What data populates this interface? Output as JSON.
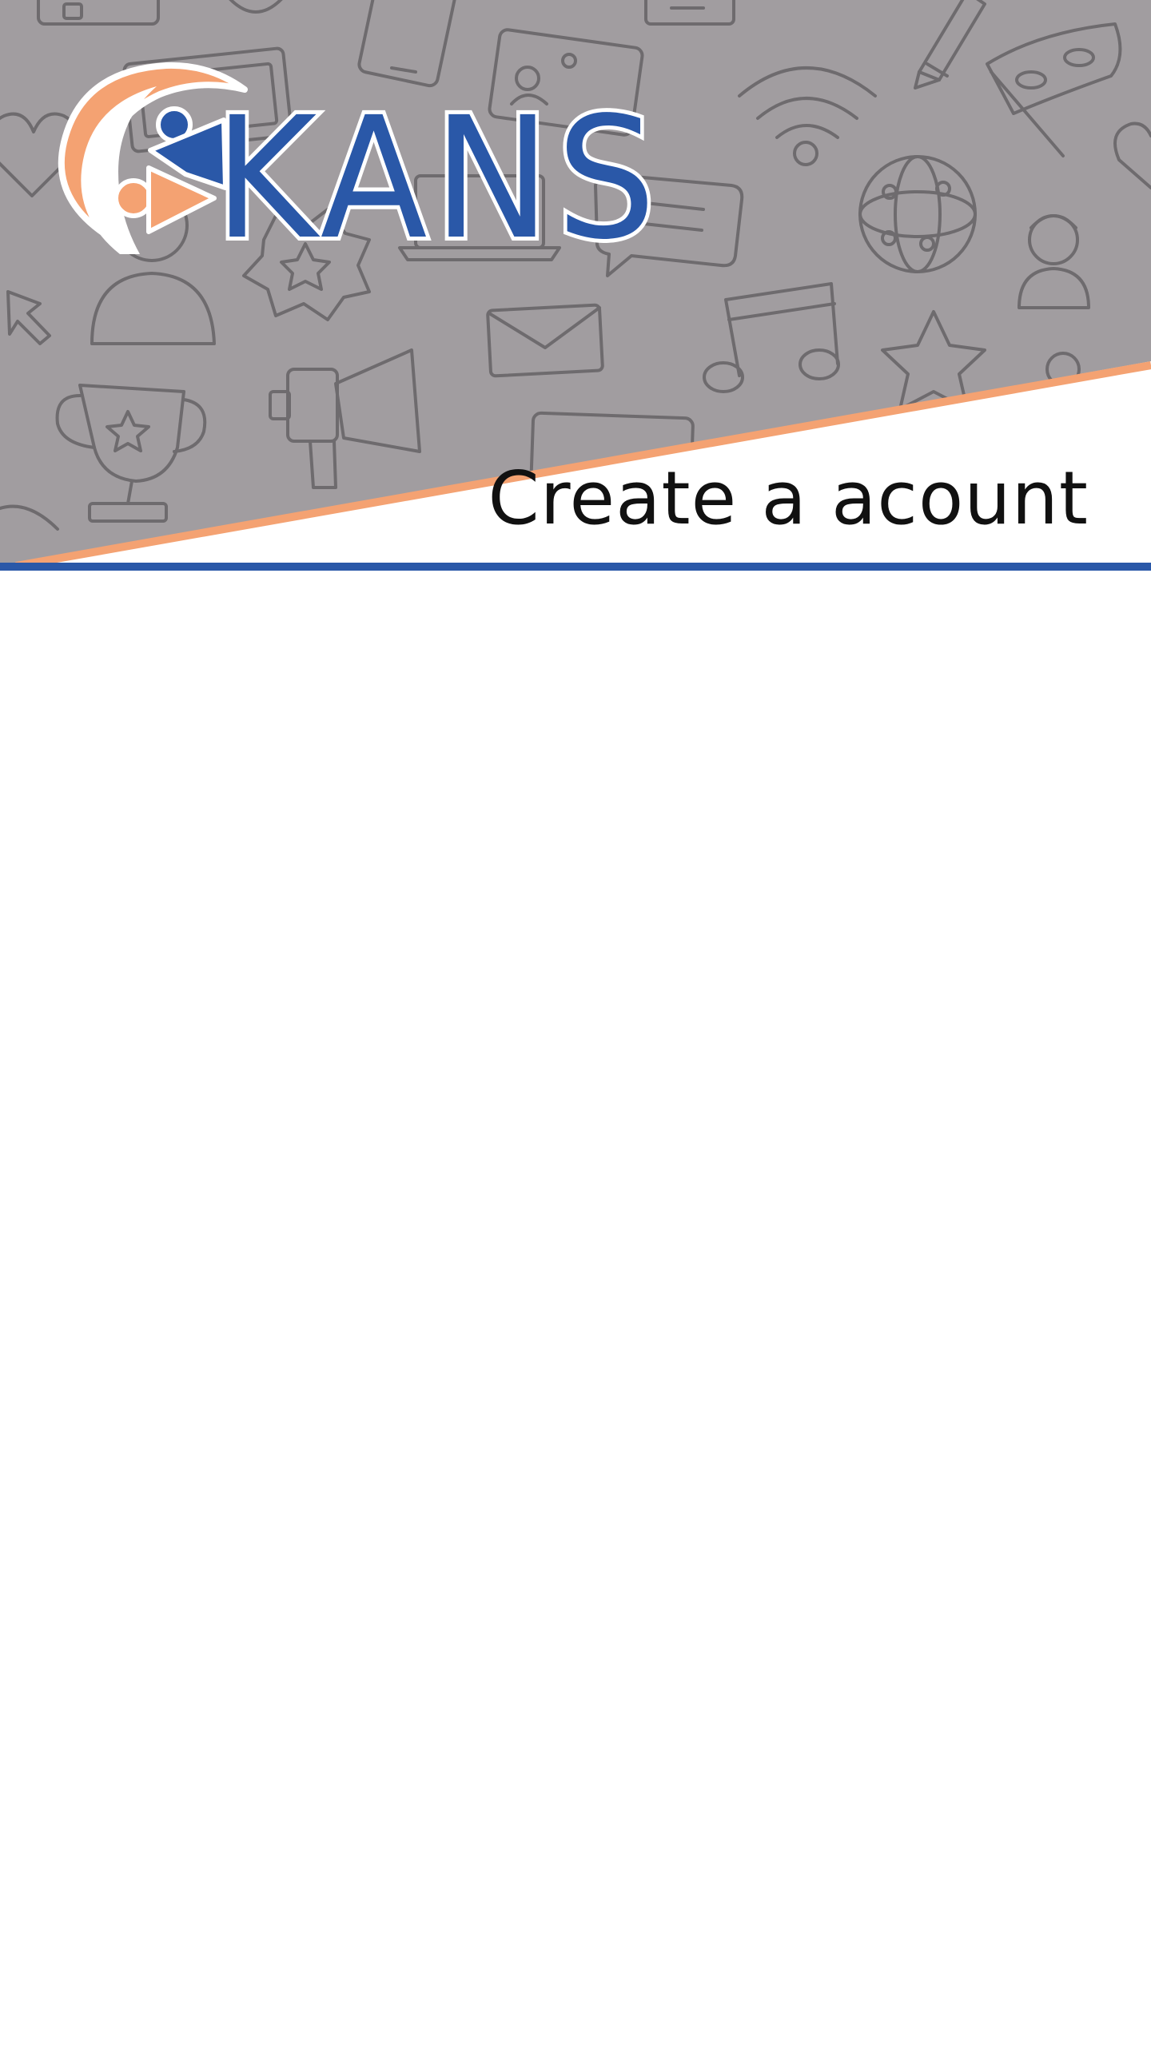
{
  "app": {
    "logo_text": "KANS",
    "title": "Create a acount"
  },
  "colors": {
    "header_background": "#a19da0",
    "pattern_stroke": "#6e6b6e",
    "accent_orange": "#f4a272",
    "brand_blue": "#2a58a8",
    "title_text": "#111111",
    "page_background": "#ffffff"
  },
  "icons": [
    "wallet-icon",
    "smartphone-icon",
    "id-card-icon",
    "wifi-icon",
    "pencil-icon",
    "mask-flag-icon",
    "heart-icon",
    "picture-frame-icon",
    "user-portrait-icon",
    "badge-star-icon",
    "chat-bubble-icon",
    "laptop-icon",
    "globe-icon",
    "user-avatar-icon",
    "cursor-arrow-icon",
    "envelope-icon",
    "music-note-icon",
    "star-icon",
    "trophy-icon",
    "megaphone-icon",
    "tablet-icon"
  ]
}
